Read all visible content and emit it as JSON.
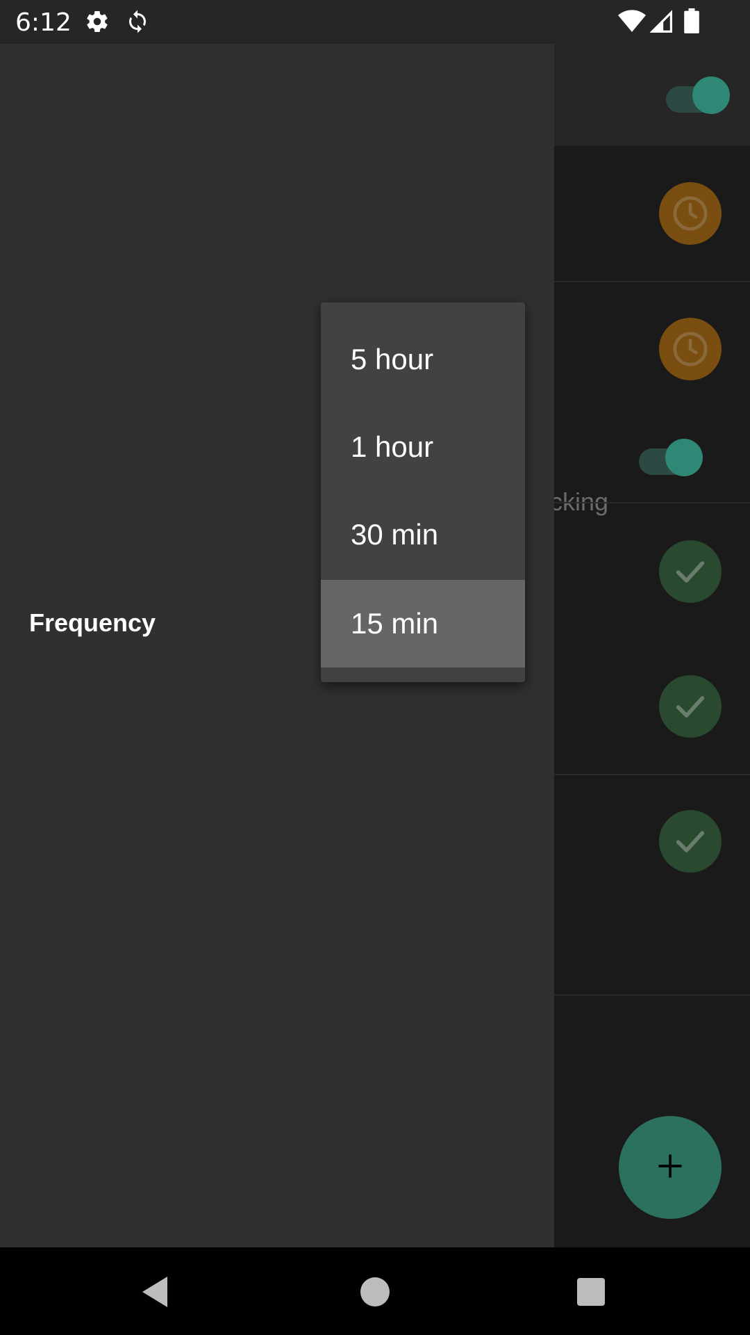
{
  "status_bar": {
    "time": "6:12",
    "icons": [
      "gear-icon",
      "sync-icon",
      "wifi-icon",
      "signal-icon",
      "battery-icon"
    ]
  },
  "background": {
    "partial_text": "cking",
    "fab_icon": "plus-icon",
    "status_icons": [
      "clock-icon",
      "clock-icon",
      "check-icon",
      "check-icon",
      "check-icon"
    ]
  },
  "drawer": {
    "frequency_label": "Frequency"
  },
  "frequency_dropdown": {
    "options": [
      "5 hour",
      "1 hour",
      "30 min",
      "15 min"
    ],
    "selected": "15 min"
  },
  "navigation_bar": {
    "buttons": [
      "back-icon",
      "home-icon",
      "recents-icon"
    ]
  },
  "colors": {
    "accent": "#2f8775",
    "drawer_bg": "#303030",
    "popup_bg": "#424242",
    "selected_bg": "#666666"
  }
}
